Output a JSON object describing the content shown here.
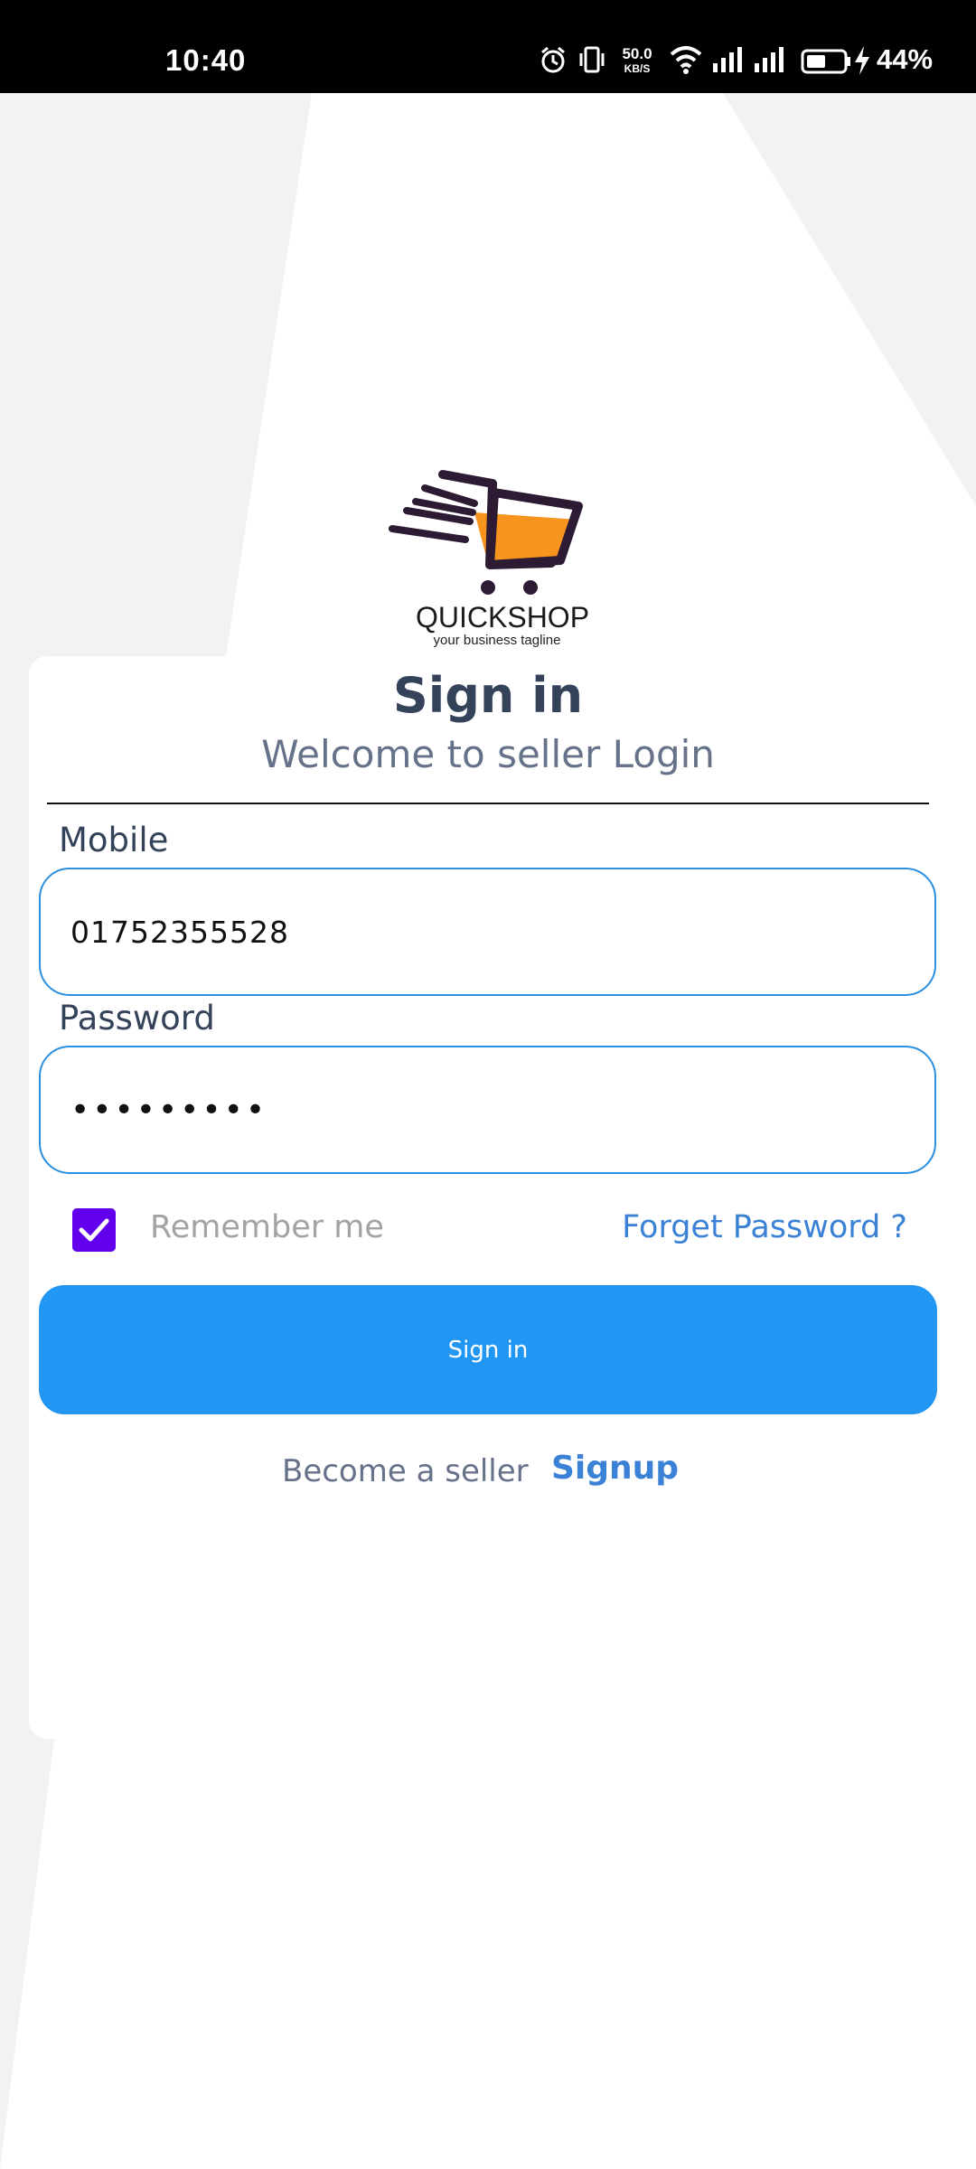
{
  "status_bar": {
    "time": "10:40",
    "speed_value": "50.0",
    "speed_unit": "KB/S",
    "battery_percent": "44%"
  },
  "brand": {
    "name": "QUICKSHOP",
    "tagline": "your business tagline",
    "colors": {
      "cart_fill": "#f7941d",
      "cart_outline": "#2d1b33"
    }
  },
  "login": {
    "title": "Sign in",
    "subtitle": "Welcome to seller Login",
    "mobile_label": "Mobile",
    "mobile_value": "01752355528",
    "password_label": "Password",
    "password_value": "•••••••••",
    "remember_label": "Remember me",
    "remember_checked": true,
    "forgot_label": "Forget Password ?",
    "signin_label": "Sign in",
    "footer_text": "Become a seller",
    "signup_label": "Signup"
  },
  "colors": {
    "primary": "#2196f3",
    "checkbox": "#6200ee",
    "link": "#3b82d6",
    "title": "#34425a"
  }
}
